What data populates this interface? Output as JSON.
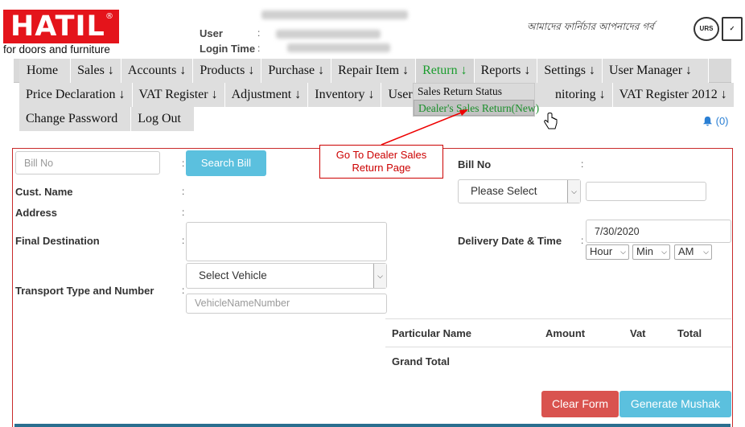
{
  "logo": {
    "brand": "HATIL",
    "registered": "®",
    "tagline": "for doors and furniture"
  },
  "user_info": {
    "user_label": "User",
    "login_label": "Login Time",
    "colon": ":"
  },
  "header": {
    "bengali_tagline": "আমাদের ফার্নিচার আপনাদের গর্ব",
    "cert1": "URS",
    "cert2": "✓"
  },
  "menu": {
    "row1": [
      "Home",
      "Sales ↓",
      "Accounts ↓",
      "Products ↓",
      "Purchase ↓",
      "Repair Item ↓",
      "Return ↓",
      "Reports ↓",
      "Settings ↓",
      "User Manager ↓"
    ],
    "row2": [
      "Price Declaration ↓",
      "VAT Register ↓",
      "Adjustment ↓",
      "Inventory ↓",
      "User'",
      "nitoring ↓",
      "VAT Register 2012 ↓"
    ],
    "row3": [
      "Change Password",
      "Log Out"
    ],
    "active": "Return ↓"
  },
  "dropdown": {
    "items": [
      "Sales Return Status",
      "Dealer's Sales Return(New)"
    ]
  },
  "notifications": {
    "count": "(0)"
  },
  "callout": {
    "text": "Go To Dealer Sales Return Page"
  },
  "form": {
    "bill_no_placeholder": "Bill No",
    "search_bill": "Search Bill",
    "cust_name": "Cust. Name",
    "address": "Address",
    "final_destination": "Final Destination",
    "transport": "Transport Type and Number",
    "vehicle_select": "Select Vehicle",
    "vehicle_placeholder": "VehicleNameNumber",
    "bill_no_label": "Bill No",
    "please_select": "Please Select",
    "delivery_label": "Delivery Date & Time",
    "date_value": "7/30/2020",
    "hour": "Hour",
    "min": "Min",
    "ampm": "AM",
    "colon": ":"
  },
  "table": {
    "headers": [
      "Particular Name",
      "Amount",
      "Vat",
      "Total"
    ],
    "grand_total": "Grand Total"
  },
  "buttons": {
    "clear": "Clear Form",
    "generate": "Generate Mushak"
  },
  "colors": {
    "brand_red": "#e4141b",
    "button_blue": "#5bc0de",
    "button_red": "#d9534f",
    "menu_active_green": "#1a9c2d",
    "panel_border": "#c92a2a"
  }
}
